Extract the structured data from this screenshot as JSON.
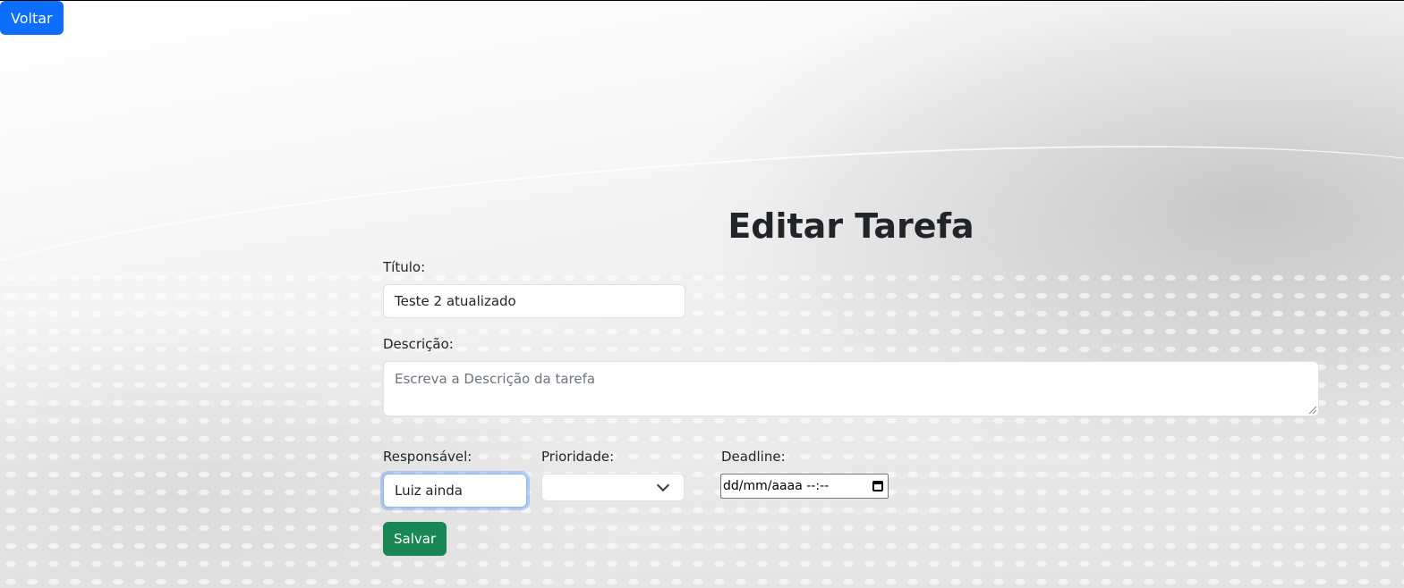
{
  "nav": {
    "back_label": "Voltar"
  },
  "page": {
    "title": "Editar Tarefa"
  },
  "form": {
    "titulo": {
      "label": "Título:",
      "value": "Teste 2 atualizado"
    },
    "descricao": {
      "label": "Descrição:",
      "value": "",
      "placeholder": "Escreva a Descrição da tarefa"
    },
    "responsavel": {
      "label": "Responsável:",
      "value": "Luiz ainda"
    },
    "prioridade": {
      "label": "Prioridade:",
      "value": ""
    },
    "deadline": {
      "label": "Deadline:",
      "value": "dd/mm/aaaa --:--"
    },
    "save_label": "Salvar"
  },
  "colors": {
    "primary": "#0d6efd",
    "success": "#198754"
  }
}
